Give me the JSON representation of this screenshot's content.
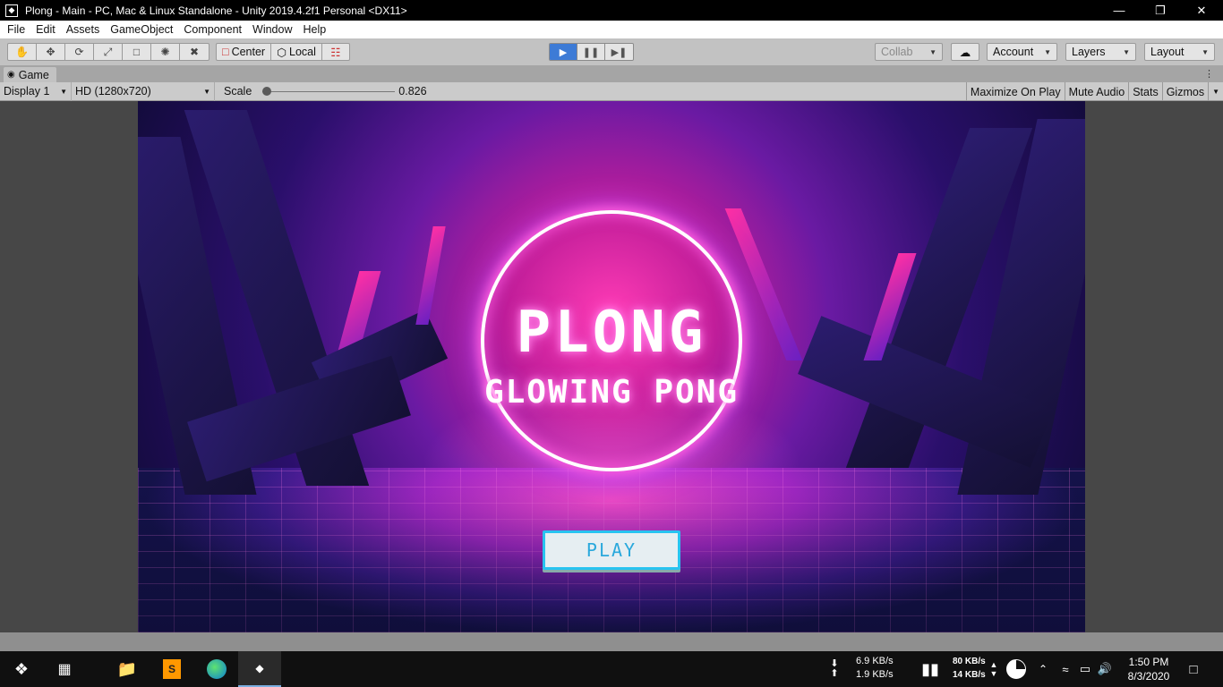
{
  "window": {
    "title": "Plong - Main - PC, Mac & Linux Standalone - Unity 2019.4.2f1 Personal <DX11>",
    "app_icon": "unity-icon",
    "controls": [
      "minimize-icon",
      "restore-icon",
      "close-icon"
    ]
  },
  "menu": [
    "File",
    "Edit",
    "Assets",
    "GameObject",
    "Component",
    "Window",
    "Help"
  ],
  "toolbar": {
    "tools": [
      "hand-icon",
      "move-icon",
      "rotate-icon",
      "scale-icon",
      "rect-icon",
      "transform-icon",
      "custom-tool-icon"
    ],
    "pivot_label": "Center",
    "space_label": "Local",
    "collab_label": "Collab",
    "account_label": "Account",
    "layers_label": "Layers",
    "layout_label": "Layout"
  },
  "game_tab": {
    "label": "Game"
  },
  "game_toolbar": {
    "display": "Display 1",
    "resolution": "HD (1280x720)",
    "scale_label": "Scale",
    "scale_value": "0.826",
    "maximize_label": "Maximize On Play",
    "mute_label": "Mute Audio",
    "stats_label": "Stats",
    "gizmos_label": "Gizmos"
  },
  "game": {
    "title": "PLONG",
    "subtitle": "GLOWING PONG",
    "play_label": "PLAY"
  },
  "taskbar": {
    "net_down": "6.9 KB/s",
    "net_up": "1.9 KB/s",
    "net2_down": "80 KB/s",
    "net2_up": "14 KB/s",
    "time": "1:50 PM",
    "date": "8/3/2020"
  },
  "colors": {
    "play_active": "#3d7bd6",
    "glow": "#ff5bdc",
    "button_border": "#28c3f0"
  }
}
